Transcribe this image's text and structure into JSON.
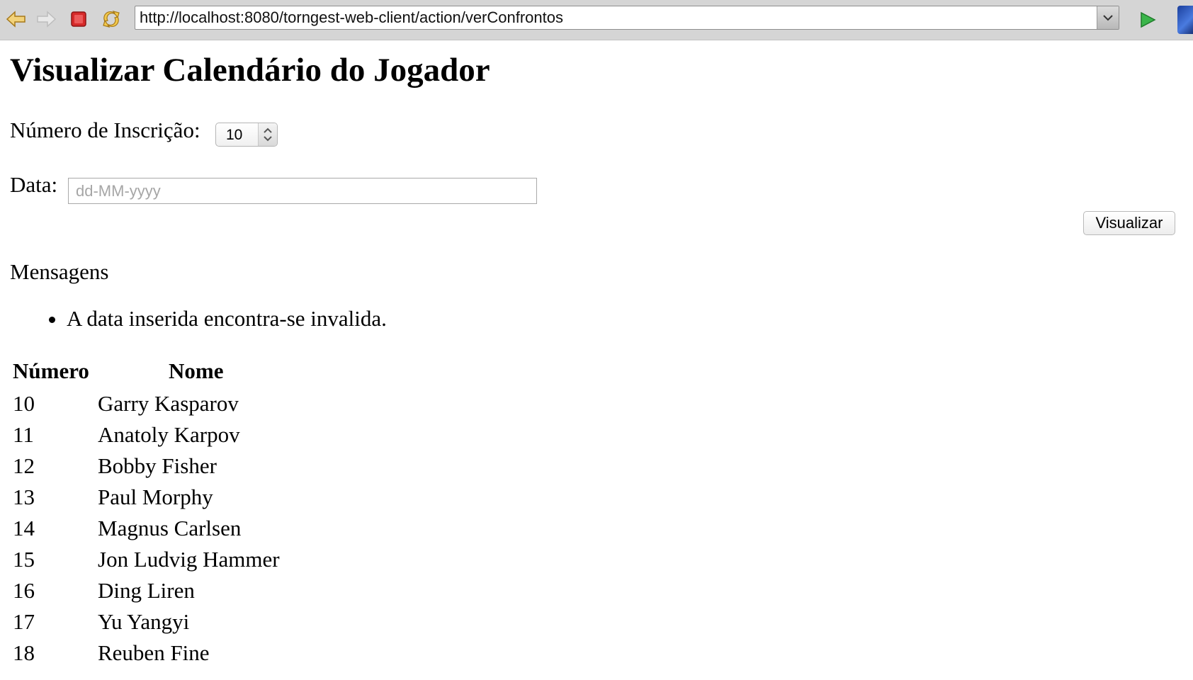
{
  "browser": {
    "url": "http://localhost:8080/torngest-web-client/action/verConfrontos"
  },
  "page": {
    "title": "Visualizar Calendário do Jogador",
    "inscription_label": "Número de Inscrição:",
    "inscription_value": "10",
    "date_label": "Data:",
    "date_placeholder": "dd-MM-yyyy",
    "date_value": "",
    "submit_label": "Visualizar"
  },
  "messages": {
    "heading": "Mensagens",
    "items": [
      "A data inserida encontra-se invalida."
    ]
  },
  "players_table": {
    "headers": {
      "number": "Número",
      "name": "Nome"
    },
    "rows": [
      {
        "number": "10",
        "name": "Garry Kasparov"
      },
      {
        "number": "11",
        "name": "Anatoly Karpov"
      },
      {
        "number": "12",
        "name": "Bobby Fisher"
      },
      {
        "number": "13",
        "name": "Paul Morphy"
      },
      {
        "number": "14",
        "name": "Magnus Carlsen"
      },
      {
        "number": "15",
        "name": "Jon Ludvig Hammer"
      },
      {
        "number": "16",
        "name": "Ding Liren"
      },
      {
        "number": "17",
        "name": "Yu Yangyi"
      },
      {
        "number": "18",
        "name": "Reuben Fine"
      }
    ]
  },
  "icons": {
    "back": "back-arrow-icon",
    "forward": "forward-arrow-icon",
    "stop": "stop-icon",
    "reload": "reload-icon",
    "url_dropdown": "chevron-down-icon",
    "go": "go-play-icon"
  },
  "colors": {
    "toolbar_bg": "#d5d5d5",
    "back_arrow": "#e0b23a",
    "stop": "#d62a2a",
    "go": "#2f9e3a"
  }
}
